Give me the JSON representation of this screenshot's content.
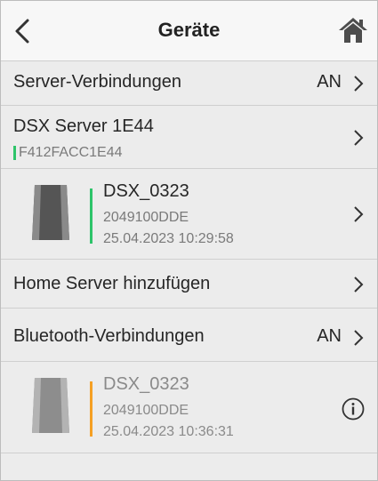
{
  "header": {
    "title": "Geräte",
    "back_icon": "chevron-left-icon",
    "home_icon": "home-icon"
  },
  "rows": {
    "server_connections": {
      "label": "Server-Verbindungen",
      "value": "AN"
    },
    "server": {
      "name": "DSX Server 1E44",
      "id": "F412FACC1E44",
      "accent": "#2ec46a"
    },
    "server_device": {
      "name": "DSX_0323",
      "serial": "2049100DDE",
      "timestamp": "25.04.2023 10:29:58",
      "status_color": "#2ec46a"
    },
    "add_home_server": {
      "label": "Home Server hinzufügen"
    },
    "bluetooth_connections": {
      "label": "Bluetooth-Verbindungen",
      "value": "AN"
    },
    "bt_device": {
      "name": "DSX_0323",
      "serial": "2049100DDE",
      "timestamp": "25.04.2023 10:36:31",
      "status_color": "#f5a024",
      "info_icon": "info-icon"
    }
  }
}
